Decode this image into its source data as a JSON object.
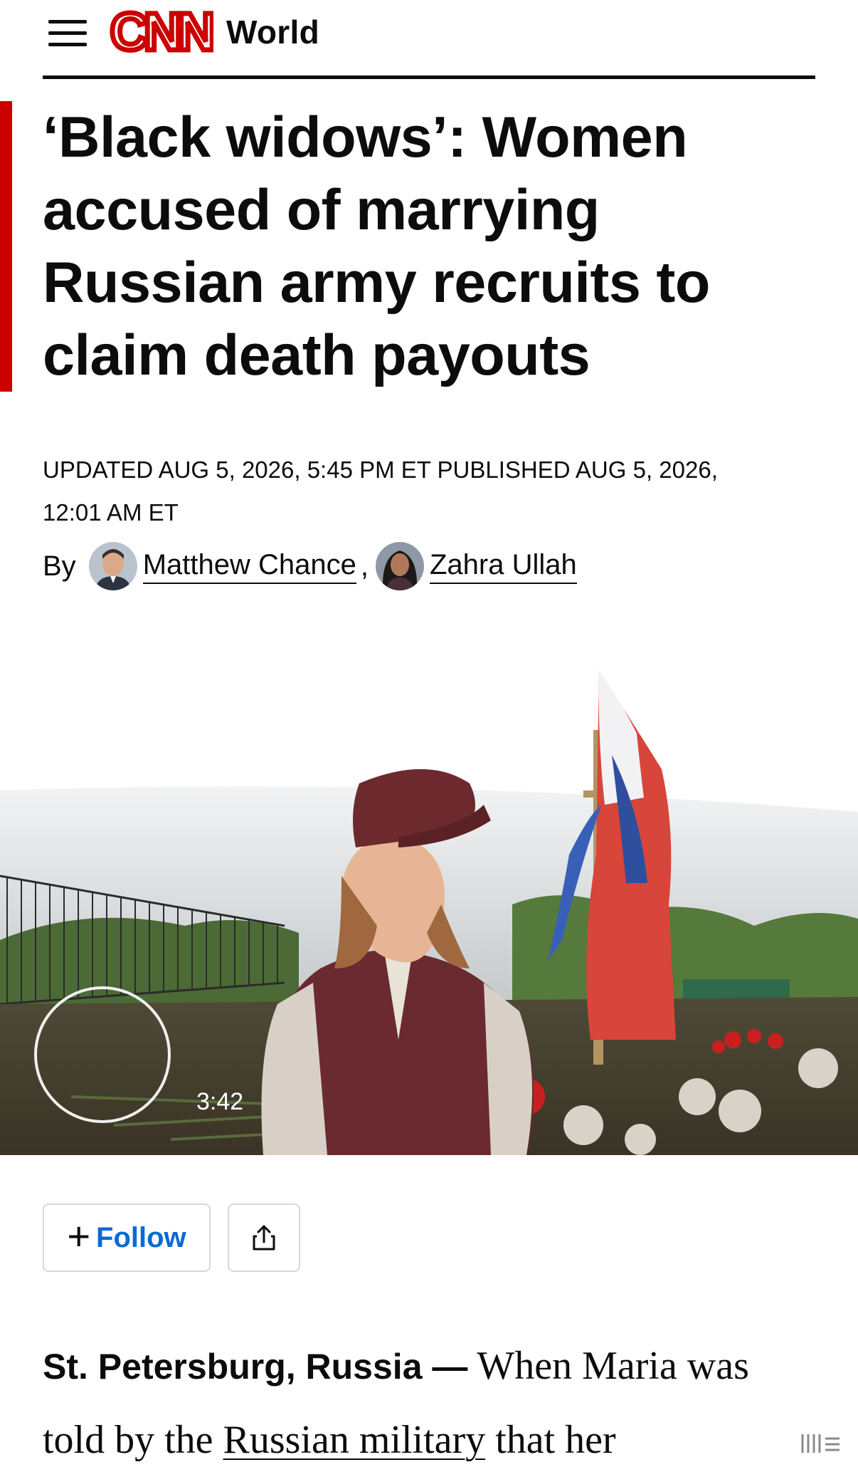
{
  "header": {
    "logo_text": "CNN",
    "section": "World",
    "brand_color": "#cc0000"
  },
  "article": {
    "headline": "‘Black widows’: Women accused of marrying Russian army recruits to claim death payouts",
    "timestamp_line1": "UPDATED AUG 5, 2026, 5:45 PM ET PUBLISHED AUG 5, 2026,",
    "timestamp_line2": "12:01 AM ET",
    "by_label": "By",
    "authors": [
      {
        "name": "Matthew Chance"
      },
      {
        "name": "Zahra Ullah"
      }
    ],
    "author_separator": ","
  },
  "video": {
    "duration": "3:42"
  },
  "actions": {
    "follow_icon": "+",
    "follow_label": "Follow",
    "share_icon": "share-icon",
    "follow_color": "#0a6ad6"
  },
  "body": {
    "dateline": "St. Petersburg, Russia —",
    "text_start": " When Maria was told by the ",
    "link_text": "Russian military",
    "text_end": " that her"
  }
}
